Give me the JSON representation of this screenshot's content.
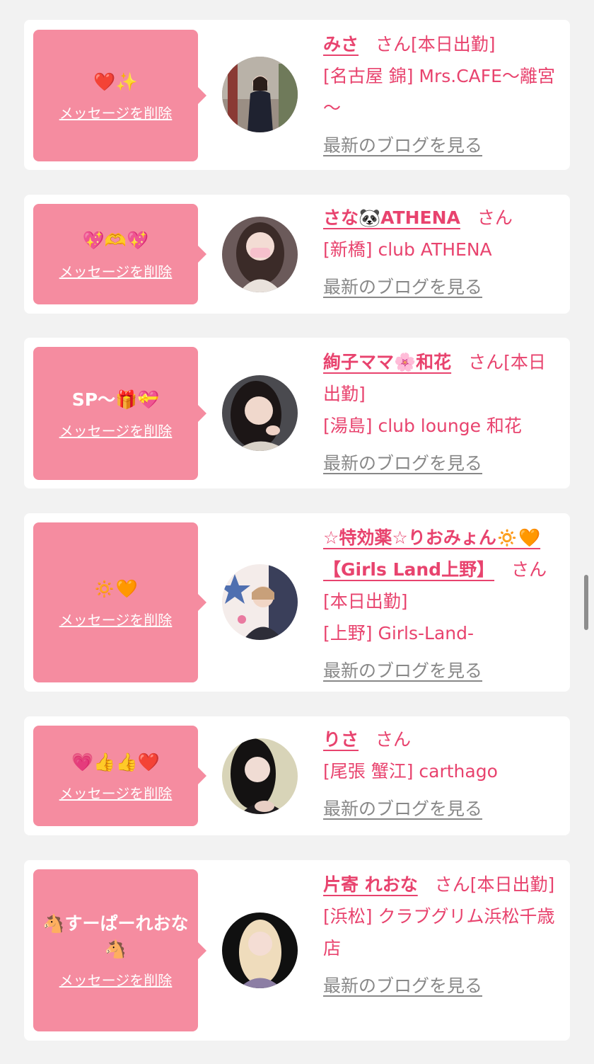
{
  "colors": {
    "page_background": "#f2f2f2",
    "card_background": "#ffffff",
    "bubble_background": "#f58ca0",
    "accent_text": "#e8436e",
    "muted_link": "#888888"
  },
  "cards": [
    {
      "message": "❤️✨",
      "delete_label": "メッセージを削除",
      "name": "みさ",
      "honorific": "さん[本日出勤]",
      "shop": "[名古屋 錦] Mrs.CAFE～離宮～",
      "blog_label": "最新のブログを見る",
      "avatar_icon": "avatar-photo-woman-dark-outfit"
    },
    {
      "message": "💖🫶💖",
      "delete_label": "メッセージを削除",
      "name": "さな🐼ATHENA",
      "honorific": "さん",
      "shop": "[新橋] club ATHENA",
      "blog_label": "最新のブログを見る",
      "avatar_icon": "avatar-photo-woman-masked"
    },
    {
      "message": "SP～🎁💝",
      "delete_label": "メッセージを削除",
      "name": "絢子ママ🌸和花",
      "honorific": "さん[本日出勤]",
      "shop": "[湯島] club lounge 和花",
      "blog_label": "最新のブログを見る",
      "avatar_icon": "avatar-photo-woman-dark-hair"
    },
    {
      "message": "🔅🧡",
      "delete_label": "メッセージを削除",
      "name": "☆特効薬☆りおみょん🔅🧡【Girls Land上野】",
      "honorific": "さん[本日出勤]",
      "shop": "[上野] Girls-Land-",
      "blog_label": "最新のブログを見る",
      "avatar_icon": "avatar-photo-woman-decorated"
    },
    {
      "message": "💗👍👍❤️",
      "delete_label": "メッセージを削除",
      "name": "りさ",
      "honorific": "さん",
      "shop": "[尾張 蟹江] carthago",
      "blog_label": "最新のブログを見る",
      "avatar_icon": "avatar-photo-woman-black-hair"
    },
    {
      "message": "🐴すーぱーれおな🐴",
      "delete_label": "メッセージを削除",
      "name": "片寄 れおな",
      "honorific": "さん[本日出勤]",
      "shop": "[浜松] クラブグリム浜松千歳店",
      "blog_label": "最新のブログを見る",
      "avatar_icon": "avatar-photo-woman-blonde"
    }
  ]
}
